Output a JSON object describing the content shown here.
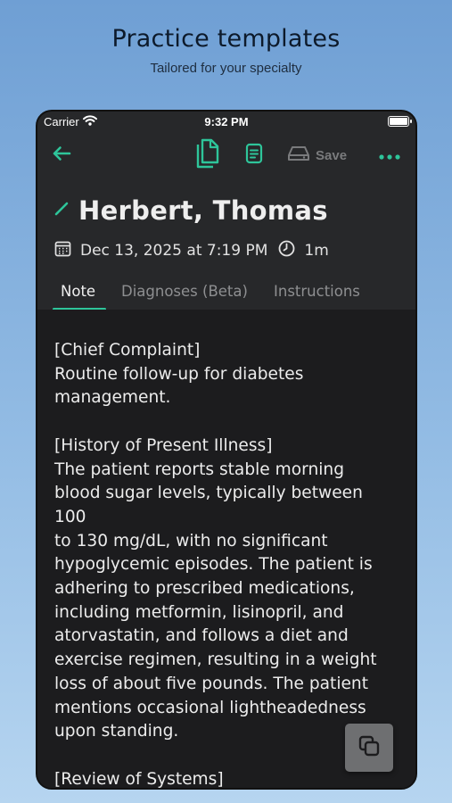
{
  "promo": {
    "title": "Practice templates",
    "subtitle": "Tailored for your specialty"
  },
  "status_bar": {
    "carrier": "Carrier",
    "time": "9:32 PM"
  },
  "toolbar": {
    "save_label": "Save",
    "accent_color": "#2ec59a",
    "disabled_color": "#7a7b7d"
  },
  "note_header": {
    "patient_name": "Herbert, Thomas",
    "date": "Dec 13, 2025 at 7:19 PM",
    "duration": "1m"
  },
  "tabs": [
    {
      "label": "Note",
      "active": true
    },
    {
      "label": "Diagnoses (Beta)",
      "active": false
    },
    {
      "label": "Instructions",
      "active": false
    }
  ],
  "note_body": "[Chief Complaint]\nRoutine follow-up for diabetes\nmanagement.\n\n[History of Present Illness]\nThe patient reports stable morning\nblood sugar levels, typically between 100\nto 130 mg/dL, with no significant\nhypoglycemic episodes. The patient is\nadhering to prescribed medications,\nincluding metformin, lisinopril, and\natorvastatin, and follows a diet and\nexercise regimen, resulting in a weight\nloss of about five pounds. The patient\nmentions occasional lightheadedness\nupon standing.\n\n[Review of Systems]\n• Endocrine: Reports stable blood sugar",
  "icons": {
    "back": "arrow-left-icon",
    "documents": "documents-icon",
    "note": "note-icon",
    "save": "drive-icon",
    "more": "more-dots-icon",
    "edit": "pencil-icon",
    "calendar": "calendar-icon",
    "clock": "clock-icon",
    "copy": "copy-icon"
  }
}
